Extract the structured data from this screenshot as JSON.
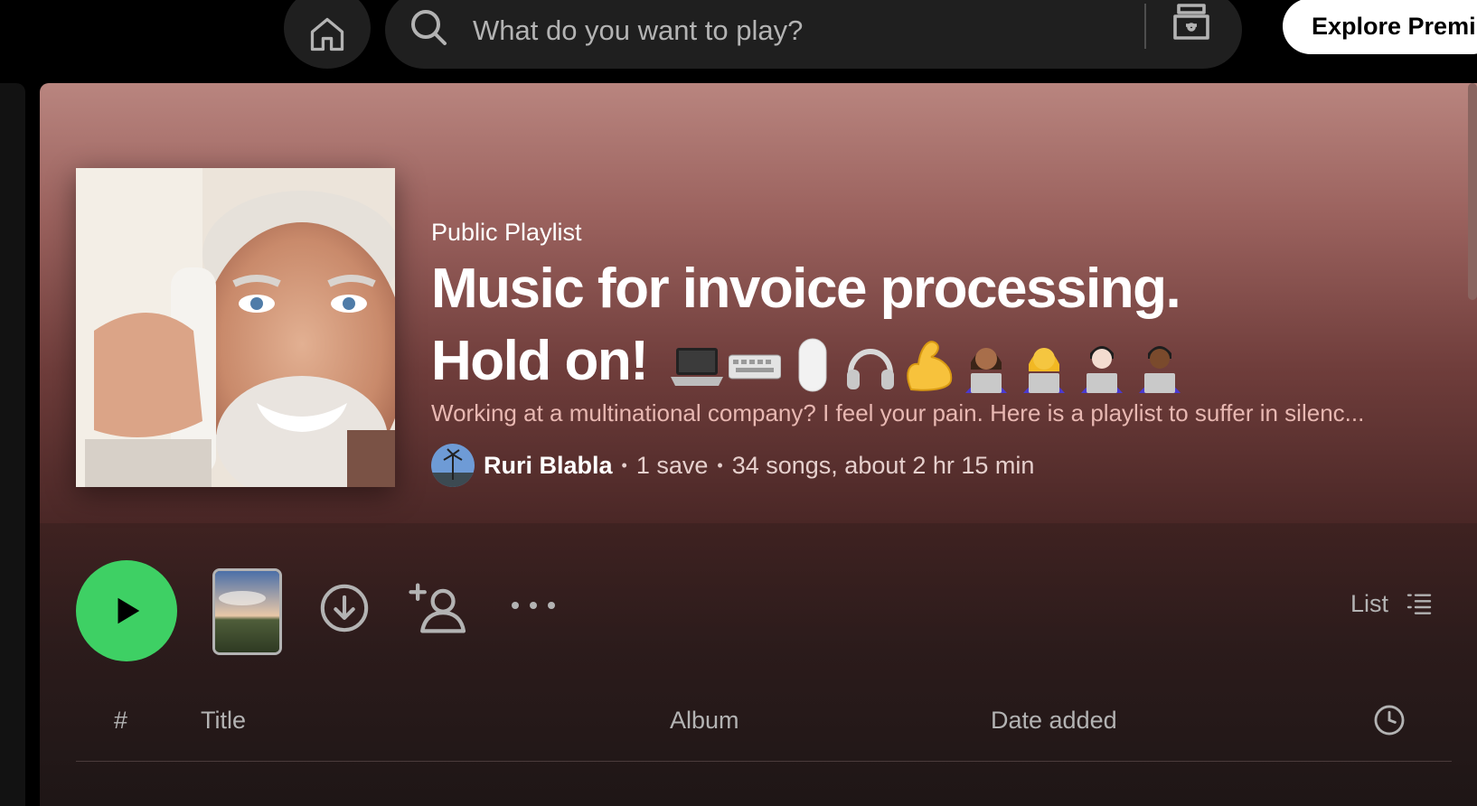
{
  "topbar": {
    "search_placeholder": "What do you want to play?",
    "explore_label": "Explore Premium"
  },
  "playlist": {
    "type": "Public Playlist",
    "title_line1": "Music for invoice processing.",
    "title_line2": "Hold on!",
    "title_emoji": [
      "💻",
      "⌨️",
      "🖱️",
      "🎧",
      "💪",
      "👩🏽‍💻",
      "👩‍💻",
      "👨🏻‍💻",
      "👨🏾‍💻"
    ],
    "description": "Working at a multinational company? I feel your pain. Here is a playlist to suffer in silenc...",
    "owner": "Ruri Blabla",
    "saves": "1 save",
    "stats": "34 songs, about 2 hr 15 min"
  },
  "actions": {
    "view_label": "List"
  },
  "table_header": {
    "hash": "#",
    "title": "Title",
    "album": "Album",
    "date_added": "Date added"
  },
  "colors": {
    "accent_green": "#3ed064",
    "hero_top": "#b9857f",
    "description_text": "#e8b8b2"
  }
}
